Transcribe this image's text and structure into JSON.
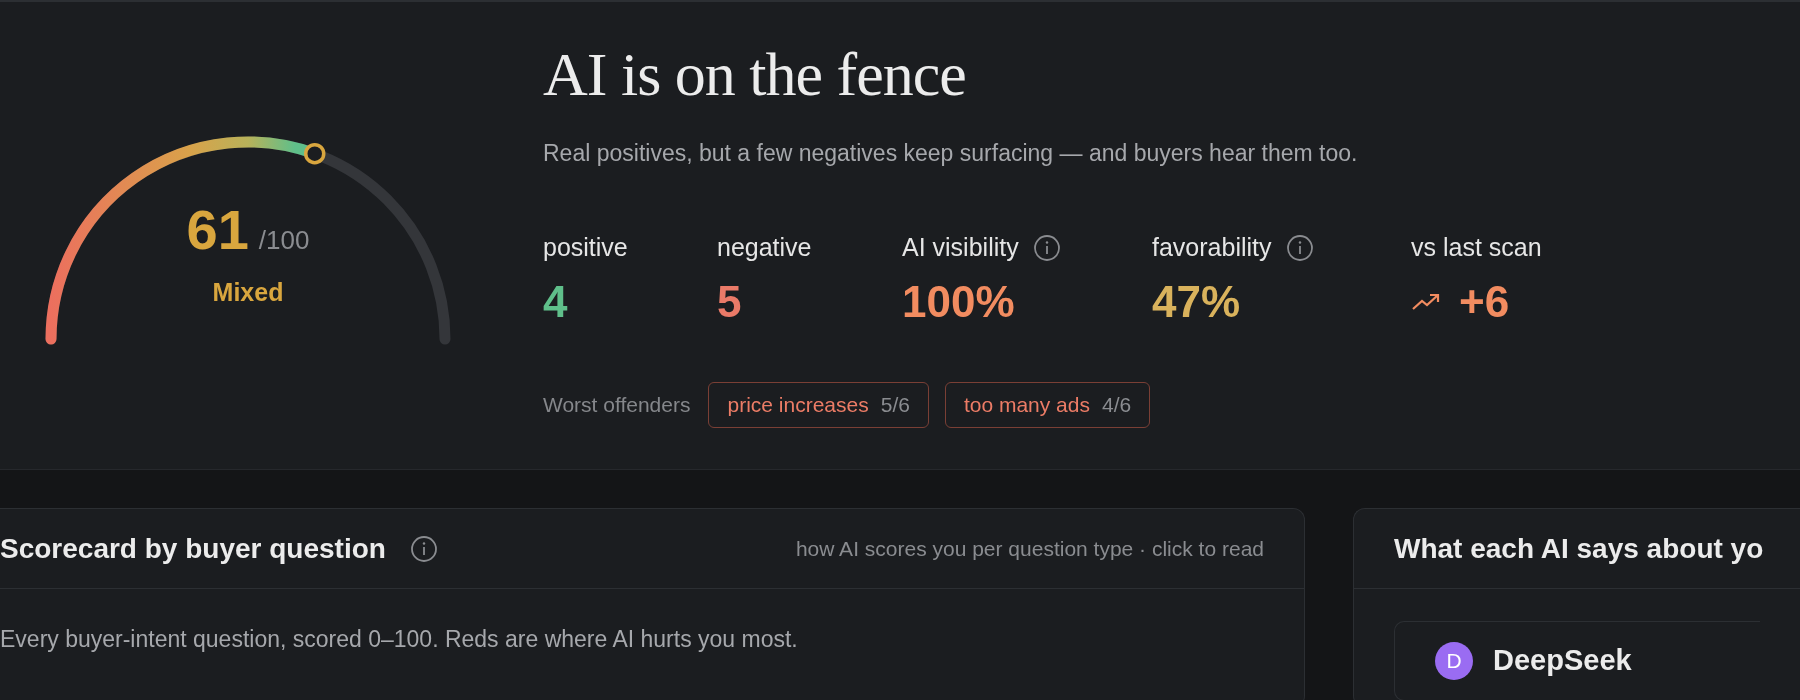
{
  "gauge": {
    "score": "61",
    "max": "/100",
    "verdict": "Mixed"
  },
  "headline": "AI is on the fence",
  "subtitle": "Real positives, but a few negatives keep surfacing — and buyers hear them too.",
  "stats": [
    {
      "kind": "plain",
      "label": "positive",
      "value": "4",
      "color": "#5fbf8a"
    },
    {
      "kind": "plain",
      "label": "negative",
      "value": "5",
      "color": "#ea7a68"
    },
    {
      "kind": "info",
      "label": "AI visibility",
      "value": "100%",
      "color": "#f28c60"
    },
    {
      "kind": "info",
      "label": "favorability",
      "value": "47%",
      "color": "#d9b25c"
    },
    {
      "kind": "trend",
      "label": "vs last scan",
      "value": "+6",
      "color": "#f28c60"
    }
  ],
  "offenders": {
    "label": "Worst offenders",
    "chips": [
      {
        "label": "price increases",
        "count": "5/6"
      },
      {
        "label": "too many ads",
        "count": "4/6"
      }
    ]
  },
  "scorecard": {
    "title": "Scorecard by buyer question",
    "hint": "how AI scores you per question type · click to read",
    "description": "Every buyer-intent question, scored 0–100. Reds are where AI hurts you most."
  },
  "ai_panel": {
    "title": "What each AI says about yo",
    "engines": [
      {
        "initial": "D",
        "name": "DeepSeek"
      }
    ]
  }
}
